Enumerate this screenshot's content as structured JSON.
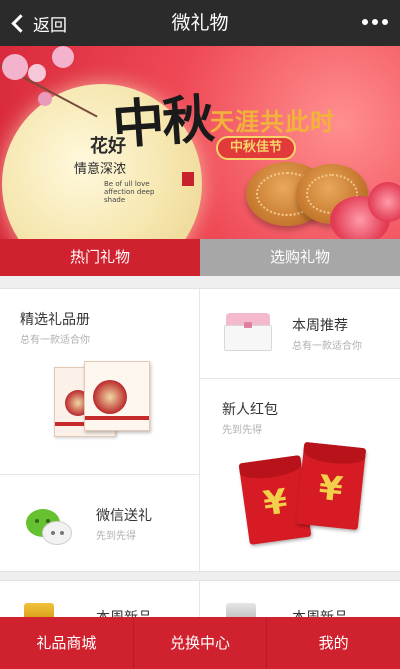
{
  "header": {
    "back_label": "返回",
    "title": "微礼物"
  },
  "banner": {
    "flower_text": "花好",
    "sentiment_text": "情意深浓",
    "english_text": "Be of ull love affection deep shade",
    "calligraphy": "中秋",
    "slogan": "天涯共此时",
    "badge": "中秋佳节",
    "carousel": {
      "count": 3,
      "active_index": 0
    }
  },
  "tabs": [
    {
      "label": "热门礼物",
      "active": true
    },
    {
      "label": "选购礼物",
      "active": false
    }
  ],
  "grid": {
    "album": {
      "title": "精选礼品册",
      "subtitle": "总有一款适合你"
    },
    "weekly": {
      "title": "本周推荐",
      "subtitle": "总有一款适合你"
    },
    "redpacket": {
      "title": "新人红包",
      "subtitle": "先到先得",
      "symbol": "¥"
    },
    "wechat": {
      "title": "微信送礼",
      "subtitle": "先到先得"
    }
  },
  "section2": {
    "left_title": "本周新品",
    "right_title": "本周新品"
  },
  "bottom_nav": [
    {
      "label": "礼品商城"
    },
    {
      "label": "兑换中心"
    },
    {
      "label": "我的"
    }
  ],
  "colors": {
    "brand_red": "#d0212e",
    "header_dark": "#2b2b2b",
    "tab_inactive": "#a7a7a7"
  }
}
